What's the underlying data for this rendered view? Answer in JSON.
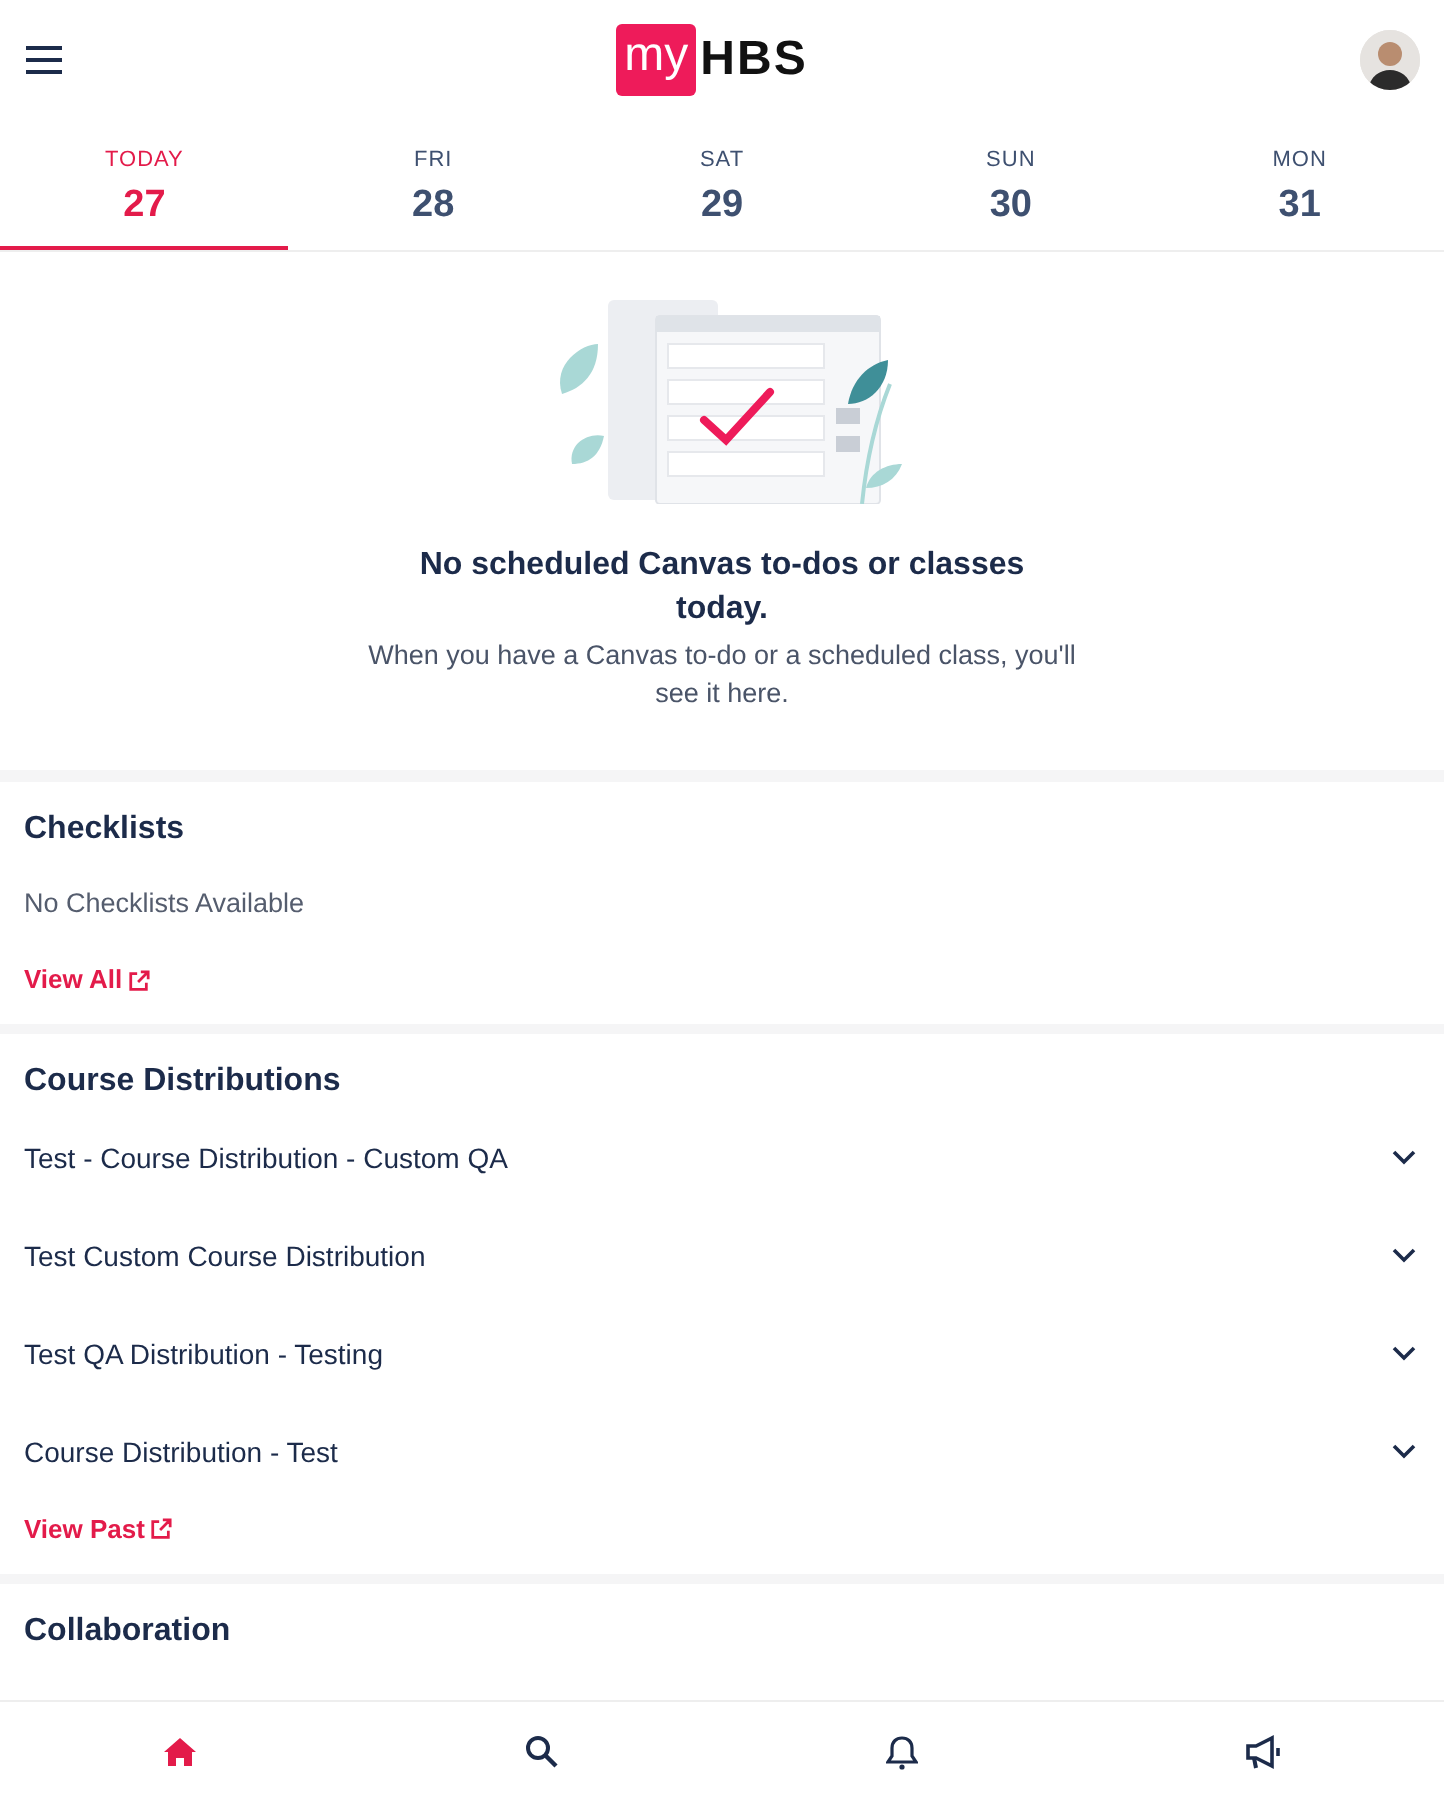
{
  "header": {
    "logo_prefix": "my",
    "logo_suffix": "HBS"
  },
  "days": [
    {
      "weekday": "TODAY",
      "date": "27",
      "selected": true
    },
    {
      "weekday": "FRI",
      "date": "28",
      "selected": false
    },
    {
      "weekday": "SAT",
      "date": "29",
      "selected": false
    },
    {
      "weekday": "SUN",
      "date": "30",
      "selected": false
    },
    {
      "weekday": "MON",
      "date": "31",
      "selected": false
    }
  ],
  "empty_state": {
    "title": "No scheduled Canvas to-dos or classes today.",
    "message": "When you have a Canvas to-do or a scheduled class, you'll see it here."
  },
  "checklists": {
    "title": "Checklists",
    "empty": "No Checklists Available",
    "link": "View All"
  },
  "course_distributions": {
    "title": "Course Distributions",
    "items": [
      {
        "label": "Test - Course Distribution - Custom QA",
        "expanded": false
      },
      {
        "label": "Test Custom Course Distribution",
        "expanded": false
      },
      {
        "label": "Test QA Distribution - Testing",
        "expanded": false
      },
      {
        "label": "Course Distribution - Test",
        "expanded": false
      }
    ],
    "link": "View Past"
  },
  "collaboration": {
    "title": "Collaboration"
  },
  "bottom_nav": [
    {
      "kind": "home",
      "selected": true
    },
    {
      "kind": "search",
      "selected": false
    },
    {
      "kind": "bell",
      "selected": false
    },
    {
      "kind": "megaphone",
      "selected": false
    }
  ]
}
